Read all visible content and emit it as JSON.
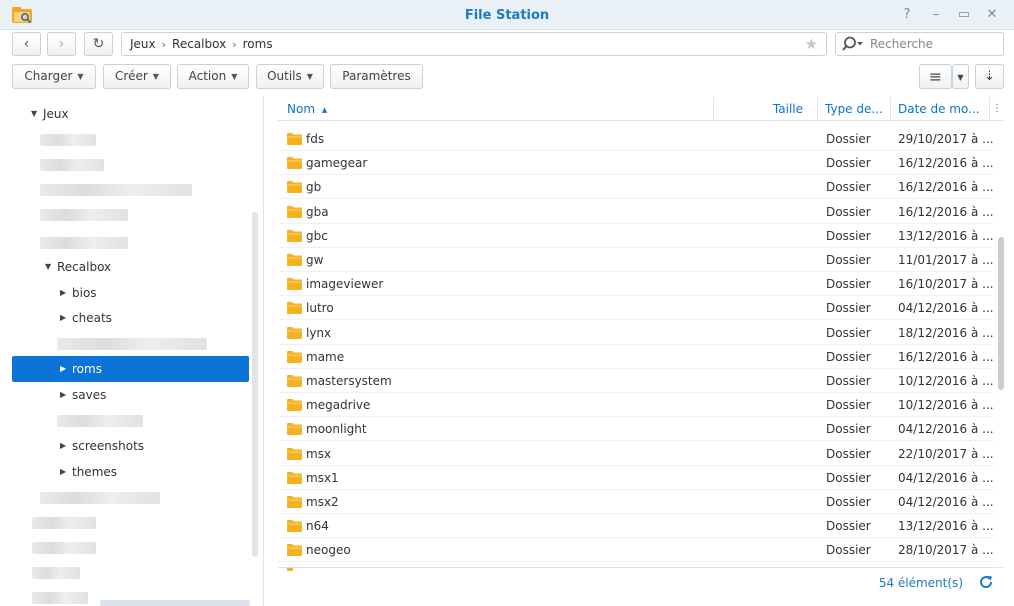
{
  "window": {
    "title": "File Station",
    "controls": [
      "help-icon",
      "minimize-icon",
      "maximize-icon",
      "close-icon"
    ]
  },
  "nav": {
    "back_icon": "chevron-left-icon",
    "forward_icon": "chevron-right-icon",
    "refresh_icon": "refresh-icon"
  },
  "address": {
    "crumbs": [
      "Jeux",
      "Recalbox",
      "roms"
    ]
  },
  "search": {
    "placeholder": "Recherche"
  },
  "toolbar": {
    "charger": "Charger",
    "creer": "Créer",
    "action": "Action",
    "outils": "Outils",
    "parametres": "Paramètres"
  },
  "tree": {
    "root": "Jeux",
    "recalbox": "Recalbox",
    "bios": "bios",
    "cheats": "cheats",
    "roms": "roms",
    "saves": "saves",
    "screenshots": "screenshots",
    "themes": "themes"
  },
  "columns": {
    "name": "Nom",
    "size": "Taille",
    "type": "Type de...",
    "date": "Date de mo..."
  },
  "files": [
    {
      "name": "fds",
      "type": "Dossier",
      "date": "29/10/2017 à ..."
    },
    {
      "name": "gamegear",
      "type": "Dossier",
      "date": "16/12/2016 à ..."
    },
    {
      "name": "gb",
      "type": "Dossier",
      "date": "16/12/2016 à ..."
    },
    {
      "name": "gba",
      "type": "Dossier",
      "date": "16/12/2016 à ..."
    },
    {
      "name": "gbc",
      "type": "Dossier",
      "date": "13/12/2016 à ..."
    },
    {
      "name": "gw",
      "type": "Dossier",
      "date": "11/01/2017 à ..."
    },
    {
      "name": "imageviewer",
      "type": "Dossier",
      "date": "16/10/2017 à ..."
    },
    {
      "name": "lutro",
      "type": "Dossier",
      "date": "04/12/2016 à ..."
    },
    {
      "name": "lynx",
      "type": "Dossier",
      "date": "18/12/2016 à ..."
    },
    {
      "name": "mame",
      "type": "Dossier",
      "date": "16/12/2016 à ..."
    },
    {
      "name": "mastersystem",
      "type": "Dossier",
      "date": "10/12/2016 à ..."
    },
    {
      "name": "megadrive",
      "type": "Dossier",
      "date": "10/12/2016 à ..."
    },
    {
      "name": "moonlight",
      "type": "Dossier",
      "date": "04/12/2016 à ..."
    },
    {
      "name": "msx",
      "type": "Dossier",
      "date": "22/10/2017 à ..."
    },
    {
      "name": "msx1",
      "type": "Dossier",
      "date": "04/12/2016 à ..."
    },
    {
      "name": "msx2",
      "type": "Dossier",
      "date": "04/12/2016 à ..."
    },
    {
      "name": "n64",
      "type": "Dossier",
      "date": "13/12/2016 à ..."
    },
    {
      "name": "neogeo",
      "type": "Dossier",
      "date": "28/10/2017 à ..."
    }
  ],
  "footer": {
    "count": "54 élément(s)"
  },
  "colors": {
    "accent": "#0c73d7",
    "title": "#1a7cc2",
    "folder": "#f5b220"
  }
}
